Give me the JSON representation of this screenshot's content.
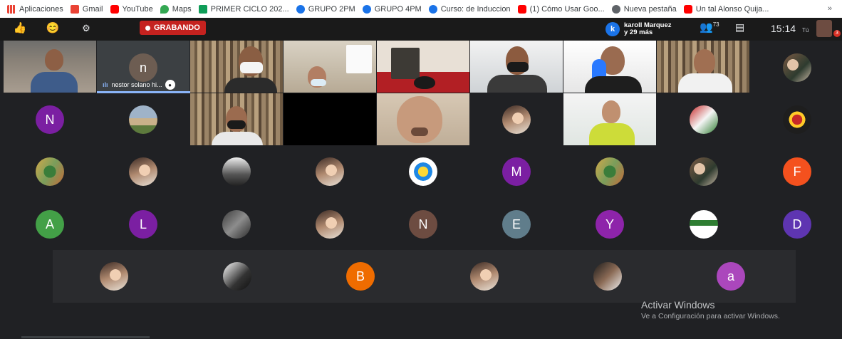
{
  "bookmarks": [
    {
      "label": "Aplicaciones",
      "icon": "apps-grid-icon",
      "color": "#ea4335"
    },
    {
      "label": "Gmail",
      "icon": "gmail-icon",
      "color": "#ea4335"
    },
    {
      "label": "YouTube",
      "icon": "youtube-icon",
      "color": "#ff0000"
    },
    {
      "label": "Maps",
      "icon": "maps-icon",
      "color": "#34a853"
    },
    {
      "label": "PRIMER CICLO 202...",
      "icon": "sheets-icon",
      "color": "#0f9d58"
    },
    {
      "label": "GRUPO 2PM",
      "icon": "globe-icon",
      "color": "#1a73e8"
    },
    {
      "label": "GRUPO 4PM",
      "icon": "globe-icon",
      "color": "#1a73e8"
    },
    {
      "label": "Curso: de Induccion",
      "icon": "globe-icon",
      "color": "#1a73e8"
    },
    {
      "label": "(1) Cómo Usar Goo...",
      "icon": "youtube-icon",
      "color": "#ff0000"
    },
    {
      "label": "Nueva pestaña",
      "icon": "chrome-icon",
      "color": "#5f6368"
    },
    {
      "label": "Un tal Alonso Quija...",
      "icon": "youtube-icon",
      "color": "#ff0000"
    }
  ],
  "bookmarks_more": "»",
  "recording": {
    "label": "GRABANDO",
    "color": "#c5221f"
  },
  "speaker": {
    "initial": "k",
    "name": "karoll Marquez",
    "others": "y 29 más"
  },
  "participants_count": "73",
  "time": "15:14",
  "you_label": "Tú",
  "notification_count": "3",
  "pinned_participant": {
    "initial": "n",
    "name": "nestor solano hi..."
  },
  "avatars_row2": [
    {
      "letter": "N",
      "color": "#7b1fa2"
    }
  ],
  "avatars_row3": [
    {
      "letter": "M",
      "color": "#7b1fa2"
    },
    {
      "letter": "F",
      "color": "#f4511e"
    }
  ],
  "avatars_row4": [
    {
      "letter": "A",
      "color": "#43a047"
    },
    {
      "letter": "L",
      "color": "#7b1fa2"
    },
    {
      "letter": "N",
      "color": "#6d4c41"
    },
    {
      "letter": "E",
      "color": "#607d8b"
    },
    {
      "letter": "Y",
      "color": "#8e24aa"
    },
    {
      "letter": "D",
      "color": "#5e35b1"
    }
  ],
  "avatars_row5": [
    {
      "letter": "B",
      "color": "#ef6c00"
    },
    {
      "letter": "a",
      "color": "#ab47bc"
    }
  ],
  "windows_watermark": {
    "title": "Activar Windows",
    "subtitle": "Ve a Configuración para activar Windows."
  }
}
